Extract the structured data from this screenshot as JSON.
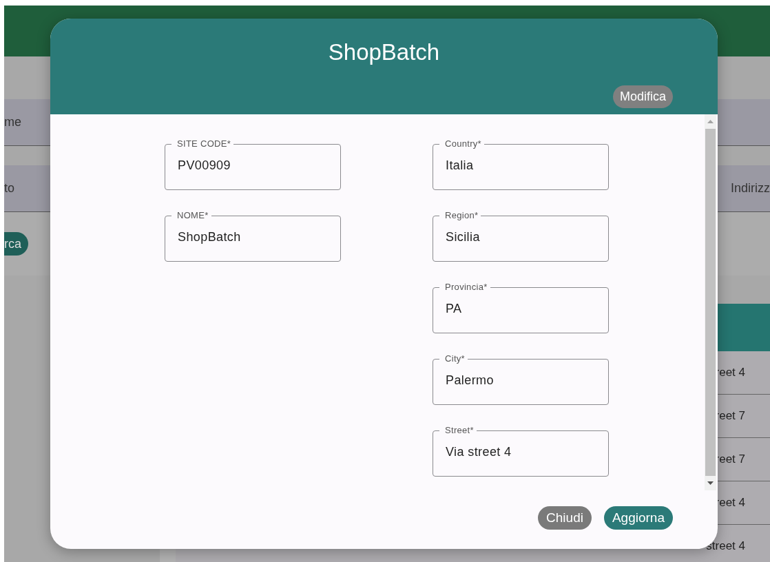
{
  "background": {
    "filter_rows": [
      {
        "label": "me"
      },
      {
        "label": "to",
        "right_label": "Indirizz"
      }
    ],
    "search_button": "rca",
    "table": {
      "rows": [
        {
          "cell": "reet 4"
        },
        {
          "cell": "reet 7"
        },
        {
          "cell": "reet 7"
        },
        {
          "cell": "reet 4"
        },
        {
          "cell": "street 4"
        }
      ]
    }
  },
  "dialog": {
    "title": "ShopBatch",
    "edit_button": "Modifica",
    "left_fields": [
      {
        "label": "SITE CODE*",
        "value": "PV00909"
      },
      {
        "label": "NOME*",
        "value": "ShopBatch"
      }
    ],
    "right_fields": [
      {
        "label": "Country*",
        "value": "Italia"
      },
      {
        "label": "Region*",
        "value": "Sicilia"
      },
      {
        "label": "Provincia*",
        "value": "PA"
      },
      {
        "label": "City*",
        "value": "Palermo"
      },
      {
        "label": "Street*",
        "value": "Via street 4"
      }
    ],
    "buttons": [
      {
        "label": "Chiudi",
        "kind": "secondary"
      },
      {
        "label": "Aggiorna",
        "kind": "primary"
      }
    ]
  }
}
